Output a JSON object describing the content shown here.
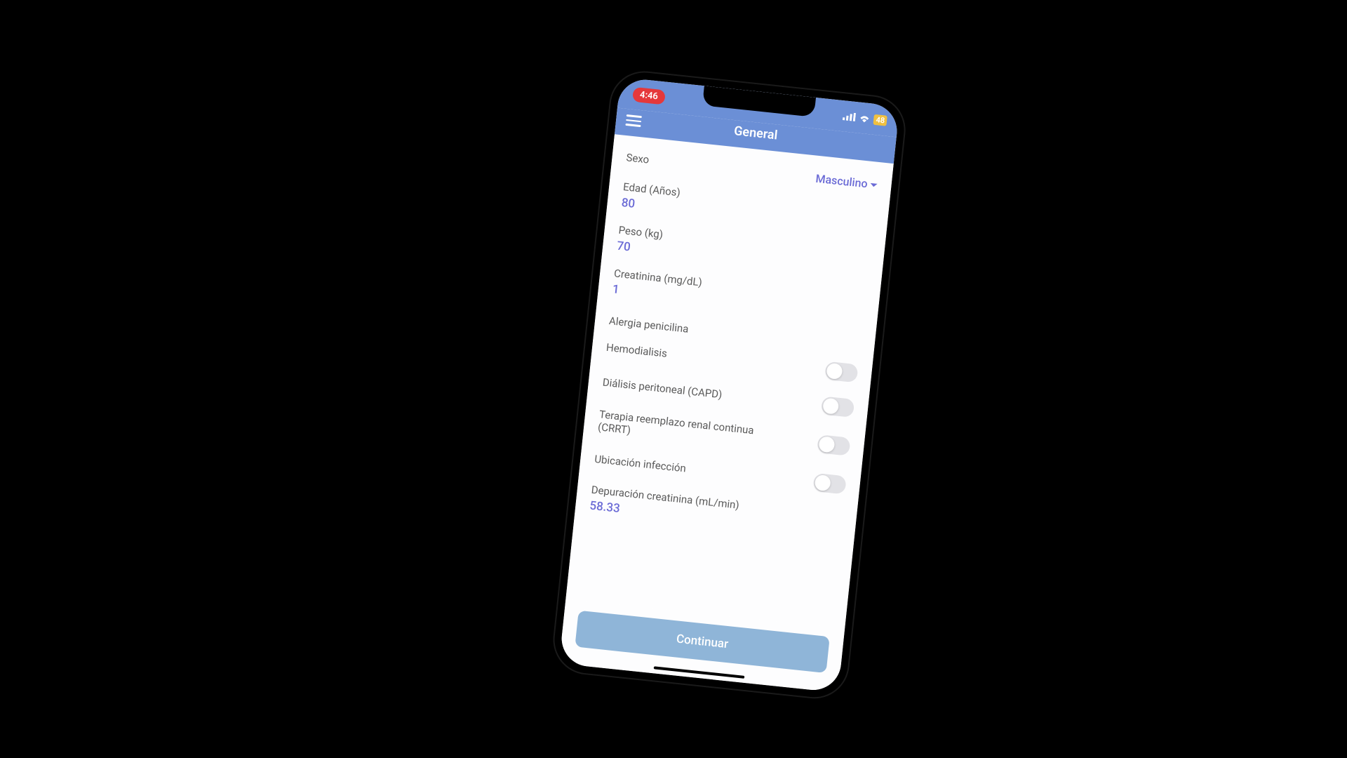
{
  "status": {
    "time": "4:46",
    "battery_level": "48"
  },
  "header": {
    "title": "General"
  },
  "form": {
    "sexo": {
      "label": "Sexo",
      "value": "Masculino"
    },
    "edad": {
      "label": "Edad (Años)",
      "value": "80"
    },
    "peso": {
      "label": "Peso (kg)",
      "value": "70"
    },
    "creatinina": {
      "label": "Creatinina (mg/dL)",
      "value": "1"
    },
    "alergia": {
      "label": "Alergia penicilina"
    },
    "hemodialisis": {
      "label": "Hemodialisis"
    },
    "capd": {
      "label": "Diálisis peritoneal (CAPD)"
    },
    "crrt": {
      "label": "Terapia reemplazo renal continua (CRRT)"
    },
    "ubicacion": {
      "label": "Ubicación infección"
    },
    "depuracion": {
      "label": "Depuración creatinina (mL/min)",
      "value": "58.33"
    }
  },
  "footer": {
    "continue_label": "Continuar"
  }
}
